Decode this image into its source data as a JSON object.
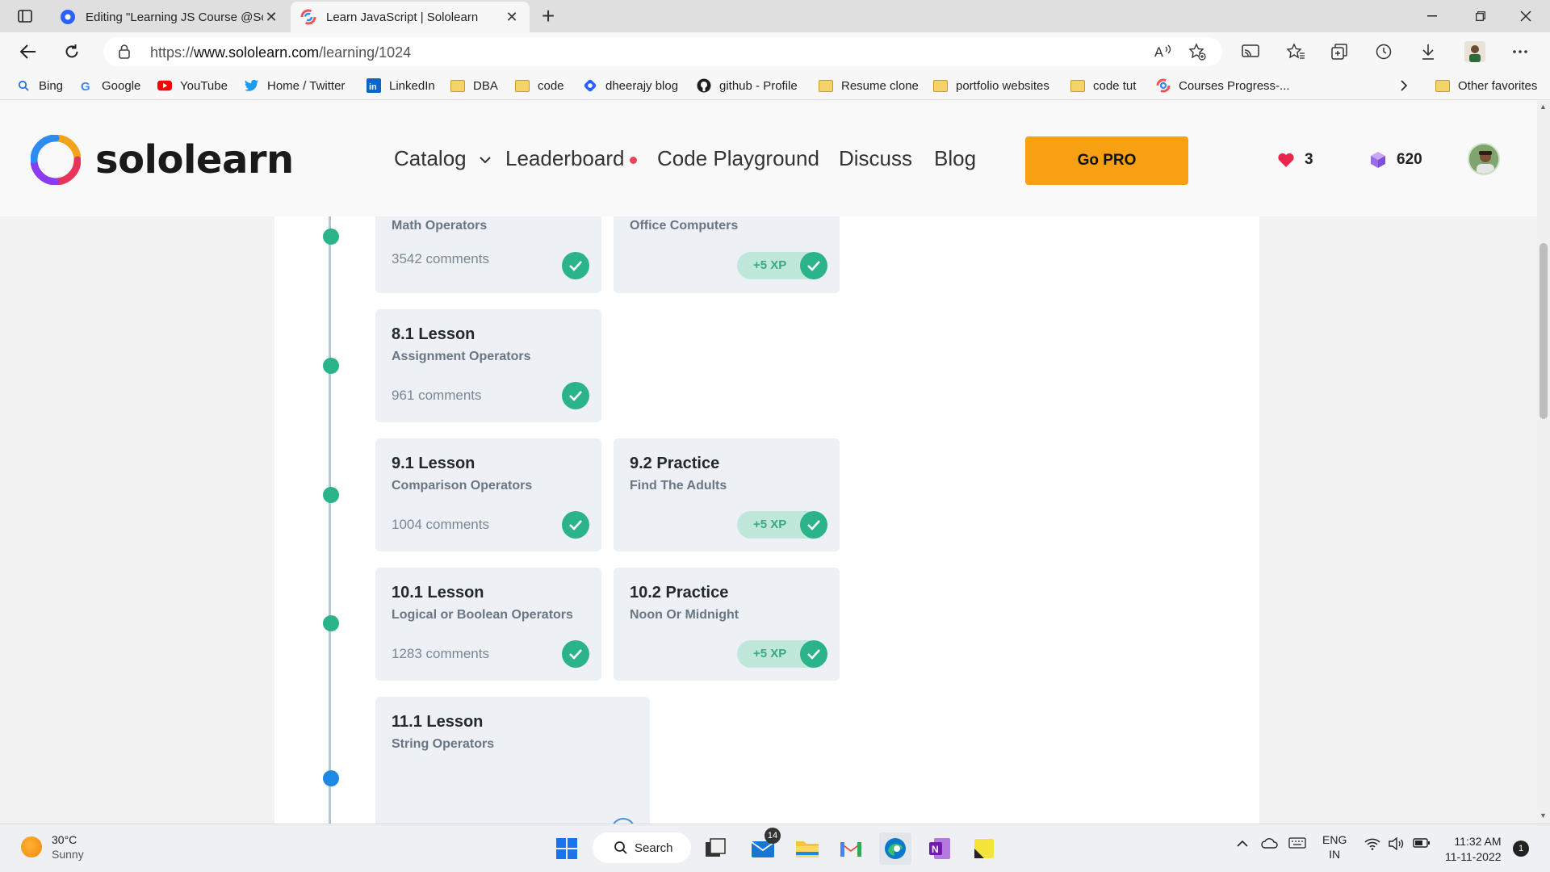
{
  "browser": {
    "tabs": [
      {
        "title": "Editing \"Learning JS Course @So",
        "active": false
      },
      {
        "title": "Learn JavaScript | Sololearn",
        "active": true
      }
    ],
    "url_prefix": "https://",
    "url_domain": "www.sololearn.com",
    "url_path": "/learning/1024",
    "favorites": [
      {
        "label": "Bing",
        "icon": "bing-search-icon"
      },
      {
        "label": "Google",
        "icon": "google-icon"
      },
      {
        "label": "YouTube",
        "icon": "youtube-icon"
      },
      {
        "label": "Home / Twitter",
        "icon": "twitter-icon"
      },
      {
        "label": "LinkedIn",
        "icon": "linkedin-icon"
      },
      {
        "label": "DBA",
        "icon": "folder-icon"
      },
      {
        "label": "code",
        "icon": "folder-icon"
      },
      {
        "label": "dheerajy blog",
        "icon": "blog-icon"
      },
      {
        "label": "github - Profile",
        "icon": "github-icon"
      },
      {
        "label": "Resume clone",
        "icon": "folder-icon"
      },
      {
        "label": "portfolio websites",
        "icon": "folder-icon"
      },
      {
        "label": "code tut",
        "icon": "folder-icon"
      },
      {
        "label": "Courses Progress-...",
        "icon": "sololearn-icon"
      }
    ],
    "other_favorites": "Other favorites"
  },
  "site": {
    "logo_text": "sololearn",
    "nav": {
      "catalog": "Catalog",
      "leaderboard": "Leaderboard",
      "playground": "Code Playground",
      "discuss": "Discuss",
      "blog": "Blog"
    },
    "go_pro": "Go PRO",
    "hearts": "3",
    "bits": "620"
  },
  "lessons": {
    "row1": {
      "left_sub": "Math Operators",
      "left_comments": "3542 comments",
      "right_sub": "Office Computers",
      "right_xp": "+5 XP"
    },
    "row2": {
      "left_kind": "8.1 Lesson",
      "left_sub": "Assignment Operators",
      "left_comments": "961 comments"
    },
    "row3": {
      "left_kind": "9.1 Lesson",
      "left_sub": "Comparison Operators",
      "left_comments": "1004 comments",
      "right_kind": "9.2 Practice",
      "right_sub": "Find The Adults",
      "right_xp": "+5 XP"
    },
    "row4": {
      "left_kind": "10.1 Lesson",
      "left_sub": "Logical or Boolean Operators",
      "left_comments": "1283 comments",
      "right_kind": "10.2 Practice",
      "right_sub": "Noon Or Midnight",
      "right_xp": "+5 XP"
    },
    "row5": {
      "left_kind": "11.1 Lesson",
      "left_sub": "String Operators"
    }
  },
  "taskbar": {
    "temp": "30°C",
    "condition": "Sunny",
    "search": "Search",
    "mail_badge": "14",
    "lang": "ENG",
    "region": "IN",
    "time": "11:32 AM",
    "date": "11-11-2022",
    "notif": "1"
  },
  "colors": {
    "accent_orange": "#f6a012",
    "complete_green": "#2bb389",
    "current_blue": "#1e88e5"
  }
}
